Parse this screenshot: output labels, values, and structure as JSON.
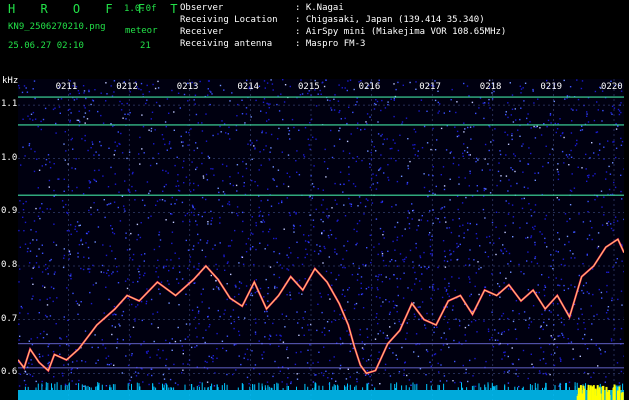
{
  "header": {
    "brand": "H R O F F T",
    "version": "1.0.0f",
    "filename": "KN9_2506270210.png",
    "meteor_label": "meteor",
    "datetime": "25.06.27 02:10",
    "meteor_count": "21"
  },
  "station_info": [
    {
      "label": "Observer",
      "value": ": K.Nagai"
    },
    {
      "label": "Receiving Location",
      "value": ": Chigasaki, Japan (139.414 35.340)"
    },
    {
      "label": "Receiver",
      "value": ": AirSpy mini (Miakejima VOR 108.65MHz)"
    },
    {
      "label": "Receiving antenna",
      "value": ": Maspro FM-3"
    }
  ],
  "colors": {
    "brand": "#22e048",
    "background": "#000010",
    "noise": "#1a1ad0",
    "baseline": "#00c8ff",
    "trace": "#ff3060",
    "meteor_bar": "#ffff00"
  },
  "chart_data": {
    "type": "heatmap",
    "ylabel": "kHz",
    "ylim": [
      0.58,
      1.17
    ],
    "y_ticks": [
      "1.1",
      "1.0",
      "0.9",
      "0.8",
      "0.7",
      "0.6"
    ],
    "x_ticks": [
      "0211",
      "0212",
      "0213",
      "0214",
      "0215",
      "0216",
      "0217",
      "0218",
      "0219",
      "0220"
    ],
    "x_range_min": [
      10,
      20
    ],
    "horizontal_lines_khz": [
      1.115,
      1.063,
      0.932,
      0.655,
      0.61
    ],
    "trace": {
      "x": [
        10.0,
        10.1,
        10.2,
        10.35,
        10.5,
        10.6,
        10.8,
        11.0,
        11.3,
        11.6,
        11.8,
        12.0,
        12.3,
        12.6,
        12.9,
        13.1,
        13.3,
        13.5,
        13.7,
        13.9,
        14.1,
        14.3,
        14.5,
        14.7,
        14.9,
        15.1,
        15.3,
        15.45,
        15.55,
        15.65,
        15.75,
        15.9,
        16.1,
        16.3,
        16.5,
        16.7,
        16.9,
        17.1,
        17.3,
        17.5,
        17.7,
        17.9,
        18.1,
        18.3,
        18.5,
        18.7,
        18.9,
        19.1,
        19.3,
        19.5,
        19.7,
        19.9,
        20.0
      ],
      "y": [
        0.625,
        0.61,
        0.645,
        0.62,
        0.605,
        0.635,
        0.625,
        0.645,
        0.69,
        0.72,
        0.745,
        0.735,
        0.77,
        0.745,
        0.775,
        0.8,
        0.775,
        0.74,
        0.725,
        0.77,
        0.72,
        0.745,
        0.78,
        0.755,
        0.795,
        0.77,
        0.73,
        0.69,
        0.65,
        0.615,
        0.6,
        0.605,
        0.655,
        0.68,
        0.73,
        0.7,
        0.69,
        0.735,
        0.745,
        0.71,
        0.755,
        0.745,
        0.765,
        0.735,
        0.755,
        0.72,
        0.745,
        0.705,
        0.78,
        0.8,
        0.835,
        0.85,
        0.825
      ]
    }
  }
}
